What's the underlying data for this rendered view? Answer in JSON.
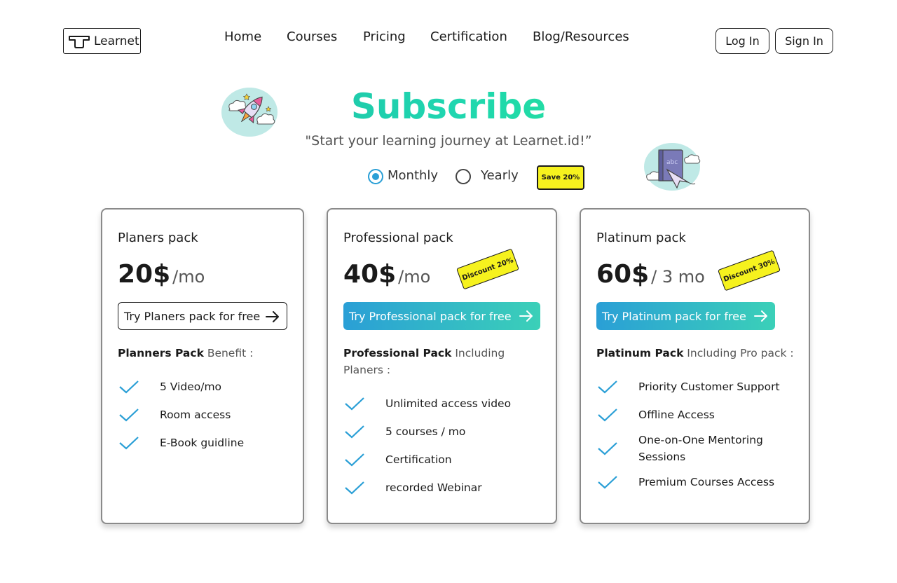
{
  "header": {
    "logo_text": "Learnet",
    "nav": [
      "Home",
      "Courses",
      "Pricing",
      "Certification",
      "Blog/Resources"
    ],
    "login_label": "Log In",
    "signin_label": "Sign In"
  },
  "hero": {
    "title": "Subscribe",
    "subtitle": "\"Start your learning journey at Learnet.id!”",
    "monthly_label": "Monthly",
    "yearly_label": "Yearly",
    "save_badge": "Save 20%",
    "selected": "Monthly"
  },
  "plans": [
    {
      "name": "Planers pack",
      "price": "20$",
      "unit": "/mo",
      "cta": "Try Planers pack for free",
      "benefit_bold": "Planners Pack",
      "benefit_rest": " Benefit :",
      "features": [
        "5 Video/mo",
        "Room access",
        "E-Book guidline"
      ]
    },
    {
      "name": "Professional pack",
      "price": "40$",
      "unit": "/mo",
      "discount": "Discount 20%",
      "cta": "Try Professional pack for free",
      "benefit_bold": "Professional Pack",
      "benefit_rest": " Including Planers :",
      "features": [
        "Unlimited access video",
        "5 courses / mo",
        "Certification",
        "recorded Webinar"
      ]
    },
    {
      "name": "Platinum pack",
      "price": "60$",
      "unit": "/ 3 mo",
      "discount": "Discount 30%",
      "cta": "Try Platinum pack for free",
      "benefit_bold": "Platinum Pack",
      "benefit_rest": " Including Pro pack :",
      "features": [
        "Priority Customer Support",
        "Offline Access",
        "One-on-One Mentoring Sessions",
        "Premium Courses Access"
      ]
    }
  ],
  "icons": {
    "check": "check-icon",
    "arrow": "arrow-right-icon",
    "rocket": "rocket-illustration",
    "book": "book-illustration"
  },
  "colors": {
    "accent_blue": "#2a9fd6",
    "accent_teal": "#1fd6b0",
    "badge_yellow": "#f6f21e"
  }
}
